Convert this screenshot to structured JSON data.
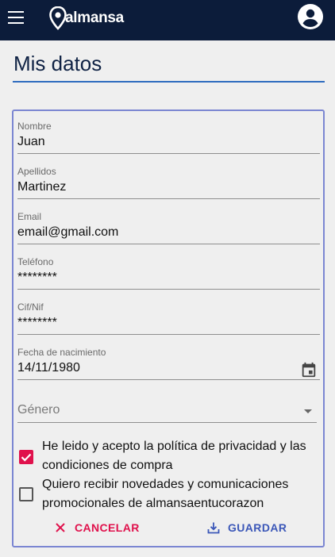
{
  "header": {
    "logo_text": "almansa",
    "menu_icon": "menu-icon",
    "account_icon": "account-circle-icon",
    "background": "#0c1c3a"
  },
  "page": {
    "title": "Mis datos"
  },
  "form": {
    "fields": [
      {
        "label": "Nombre",
        "value": "Juan"
      },
      {
        "label": "Apellidos",
        "value": "Martinez"
      },
      {
        "label": "Email",
        "value": "email@gmail.com"
      },
      {
        "label": "Teléfono",
        "value": "********"
      },
      {
        "label": "Cif/Nif",
        "value": "********"
      },
      {
        "label": "Fecha de nacimiento",
        "value": "14/11/1980"
      }
    ],
    "gender": {
      "placeholder": "Género"
    },
    "privacy": {
      "label": "He leido y acepto la política de privacidad y las condiciones de compra",
      "checked": true
    },
    "newsletter": {
      "label": "Quiero recibir novedades y comunicaciones promocionales de almansaentucorazon",
      "checked": false
    },
    "cancel_label": "CANCELAR",
    "save_label": "GUARDAR"
  },
  "colors": {
    "accent_pink": "#e0114c",
    "accent_blue": "#3b57b8",
    "card_border": "#7b86d2",
    "title_rule": "#2e6bbf"
  }
}
